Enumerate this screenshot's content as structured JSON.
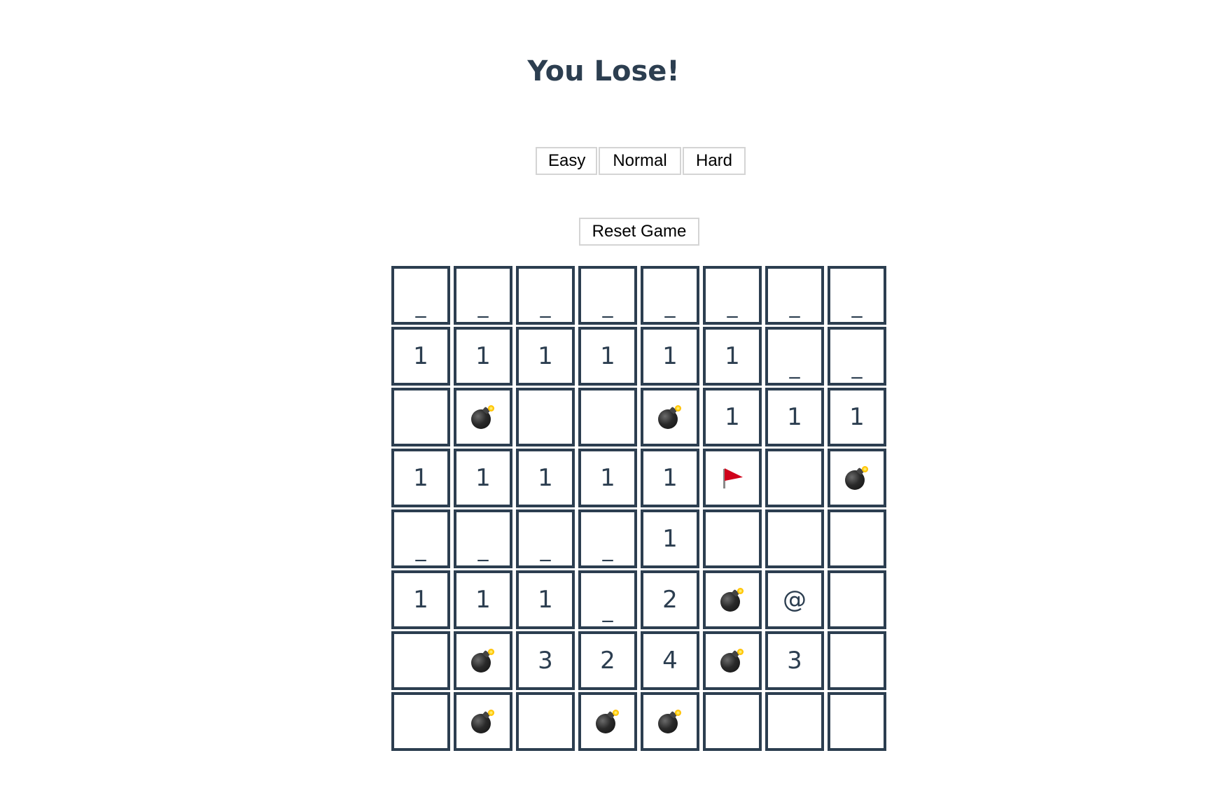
{
  "title": "You Lose!",
  "difficulty": {
    "easy_label": "Easy",
    "normal_label": "Normal",
    "hard_label": "Hard"
  },
  "reset_label": "Reset Game",
  "colors": {
    "text": "#2c3e50",
    "cell_border": "#2c3e50",
    "button_border": "#d4d4d4",
    "flag": "#d0021b"
  },
  "board": {
    "rows": 8,
    "cols": 8,
    "legend": {
      "_": "hidden",
      "B": "bomb-icon",
      "F": "flag-icon",
      "": "empty"
    },
    "cells": [
      [
        "_",
        "_",
        "_",
        "_",
        "_",
        "_",
        "_",
        "_"
      ],
      [
        "1",
        "1",
        "1",
        "1",
        "1",
        "1",
        "_",
        "_"
      ],
      [
        "",
        "B",
        "",
        "",
        "B",
        "1",
        "1",
        "1"
      ],
      [
        "1",
        "1",
        "1",
        "1",
        "1",
        "F",
        "",
        "B"
      ],
      [
        "_",
        "_",
        "_",
        "_",
        "1",
        "",
        "",
        ""
      ],
      [
        "1",
        "1",
        "1",
        "_",
        "2",
        "B",
        "@",
        ""
      ],
      [
        "",
        "B",
        "3",
        "2",
        "4",
        "B",
        "3",
        ""
      ],
      [
        "",
        "B",
        "",
        "B",
        "B",
        "",
        "",
        ""
      ]
    ]
  }
}
